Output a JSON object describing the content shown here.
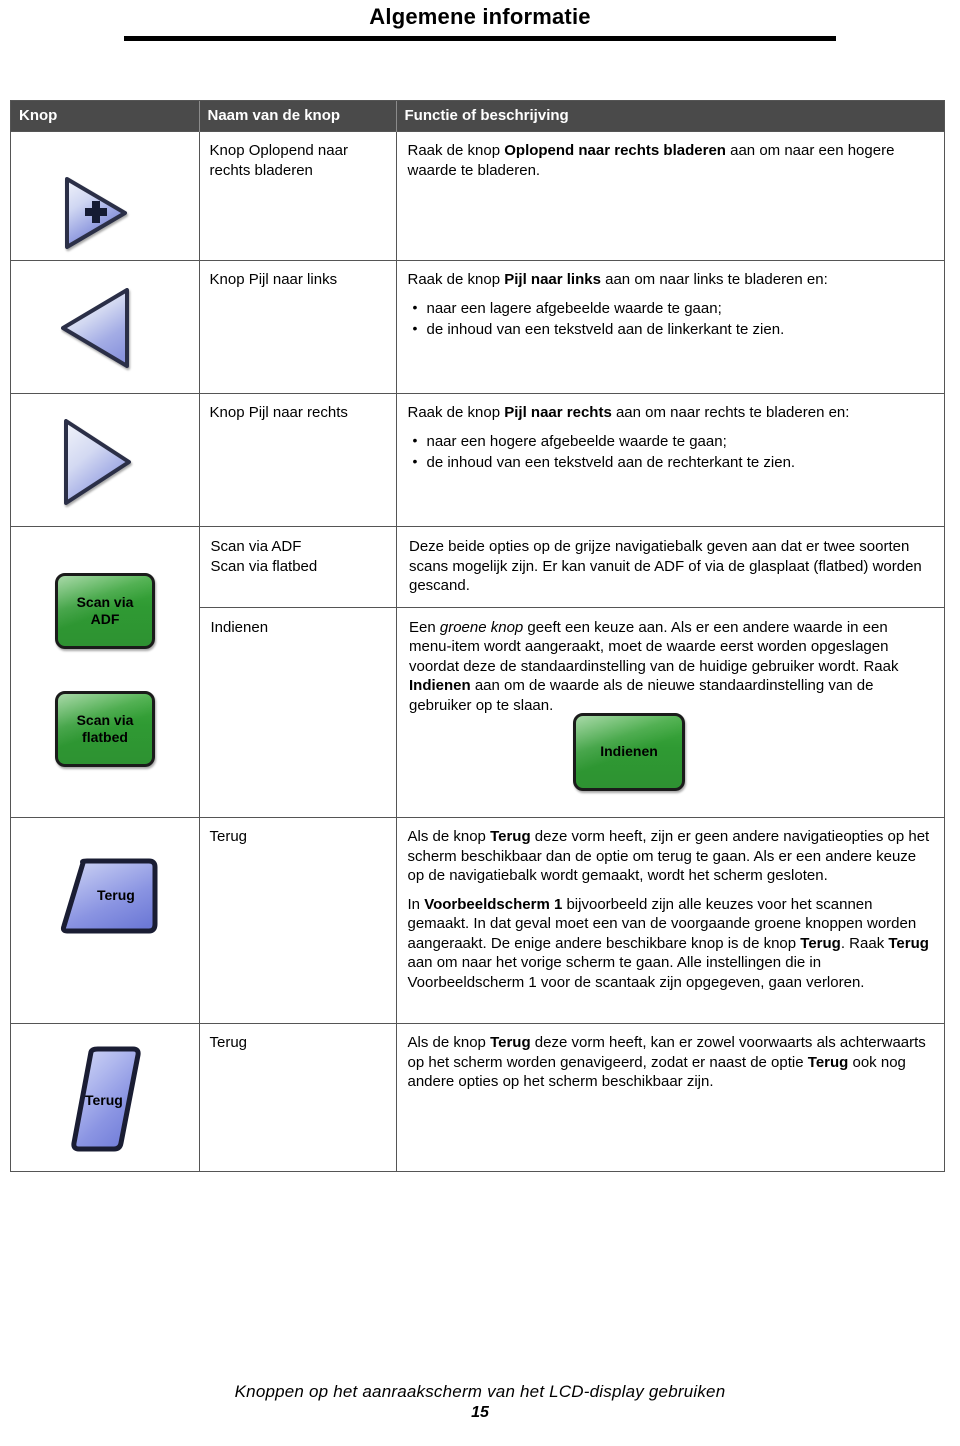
{
  "document": {
    "title": "Algemene informatie",
    "footer_text": "Knoppen op het aanraakscherm van het LCD-display gebruiken",
    "page_number": "15"
  },
  "colors": {
    "header_bg": "#4a4a4a",
    "header_text": "#ffffff",
    "border": "#555555",
    "green_button": "#2f9a33",
    "blue_button": "#7b86e0",
    "rule": "#000000"
  },
  "table": {
    "columns": [
      {
        "key": "button",
        "label": "Knop"
      },
      {
        "key": "name",
        "label": "Naam van de knop"
      },
      {
        "key": "description",
        "label": "Functie of beschrijving"
      }
    ],
    "rows": [
      {
        "icon": "scroll-right-increase-triangle-icon",
        "name": "Knop Oplopend naar rechts bladeren",
        "desc_lead": "Raak de knop ",
        "desc_bold": "Oplopend naar rechts bladeren",
        "desc_tail": " aan om naar een hogere waarde te bladeren."
      },
      {
        "icon": "arrow-left-triangle-icon",
        "name": "Knop Pijl naar links",
        "desc_lead": "Raak de knop ",
        "desc_bold": "Pijl naar links",
        "desc_tail": " aan om naar links te bladeren en:",
        "bullets": [
          "naar een lagere afgebeelde waarde te gaan;",
          "de inhoud van een tekstveld aan de linkerkant te zien."
        ]
      },
      {
        "icon": "arrow-right-triangle-icon",
        "name": "Knop Pijl naar rechts",
        "desc_lead": "Raak de knop ",
        "desc_bold": "Pijl naar rechts",
        "desc_tail": " aan om naar rechts te bladeren en:",
        "bullets": [
          "naar een hogere afgebeelde waarde te gaan;",
          "de inhoud van een tekstveld aan de rechterkant te zien."
        ]
      }
    ],
    "green_row": {
      "buttons": [
        {
          "icon": "scan-via-adf-button",
          "line1": "Scan via",
          "line2": "ADF"
        },
        {
          "icon": "scan-via-flatbed-button",
          "line1": "Scan via",
          "line2": "flatbed"
        },
        {
          "icon": "indienen-button",
          "line1": "Indienen",
          "line2": ""
        }
      ],
      "sub_rows": [
        {
          "names": [
            "Scan via ADF",
            "Scan via flatbed"
          ],
          "desc": "Deze beide opties op de grijze navigatiebalk geven aan dat er twee soorten scans mogelijk zijn. Er kan vanuit de ADF of via de glasplaat (flatbed) worden gescand."
        },
        {
          "names": [
            "Indienen"
          ],
          "desc_part1": "Een ",
          "desc_italic": "groene knop",
          "desc_part2": " geeft een keuze aan. Als er een andere waarde in een menu-item wordt aangeraakt, moet de waarde eerst worden opgeslagen voordat deze de standaardinstelling van de huidige gebruiker wordt. Raak ",
          "desc_bold": "Indienen",
          "desc_part3": " aan om de waarde als de nieuwe standaardinstelling van de gebruiker op te slaan."
        }
      ]
    },
    "terug_rows": [
      {
        "icon": "terug-trapezoid-button",
        "icon_label": "Terug",
        "name": "Terug",
        "paragraphs": [
          {
            "segments": [
              {
                "t": "Als de knop "
              },
              {
                "t": "Terug",
                "b": true
              },
              {
                "t": " deze vorm heeft, zijn er geen andere navigatieopties op het scherm beschikbaar dan de optie om terug te gaan. Als er een andere keuze op de navigatiebalk wordt gemaakt, wordt het scherm gesloten."
              }
            ]
          },
          {
            "segments": [
              {
                "t": "In "
              },
              {
                "t": "Voorbeeldscherm 1",
                "b": true
              },
              {
                "t": " bijvoorbeeld zijn alle keuzes voor het scannen gemaakt. In dat geval moet een van de voorgaande groene knoppen worden aangeraakt. De enige andere beschikbare knop is de knop "
              },
              {
                "t": "Terug",
                "b": true
              },
              {
                "t": ". Raak "
              },
              {
                "t": "Terug",
                "b": true
              },
              {
                "t": " aan om naar het vorige scherm te gaan. Alle instellingen die in Voorbeeldscherm 1 voor de scantaak zijn opgegeven, gaan verloren."
              }
            ]
          }
        ]
      },
      {
        "icon": "terug-parallelogram-button",
        "icon_label": "Terug",
        "name": "Terug",
        "paragraphs": [
          {
            "segments": [
              {
                "t": "Als de knop "
              },
              {
                "t": "Terug",
                "b": true
              },
              {
                "t": " deze vorm heeft, kan er zowel voorwaarts als achterwaarts op het scherm worden genavigeerd, zodat er naast de optie "
              },
              {
                "t": "Terug",
                "b": true
              },
              {
                "t": " ook nog andere opties op het scherm beschikbaar zijn."
              }
            ]
          }
        ]
      }
    ]
  }
}
